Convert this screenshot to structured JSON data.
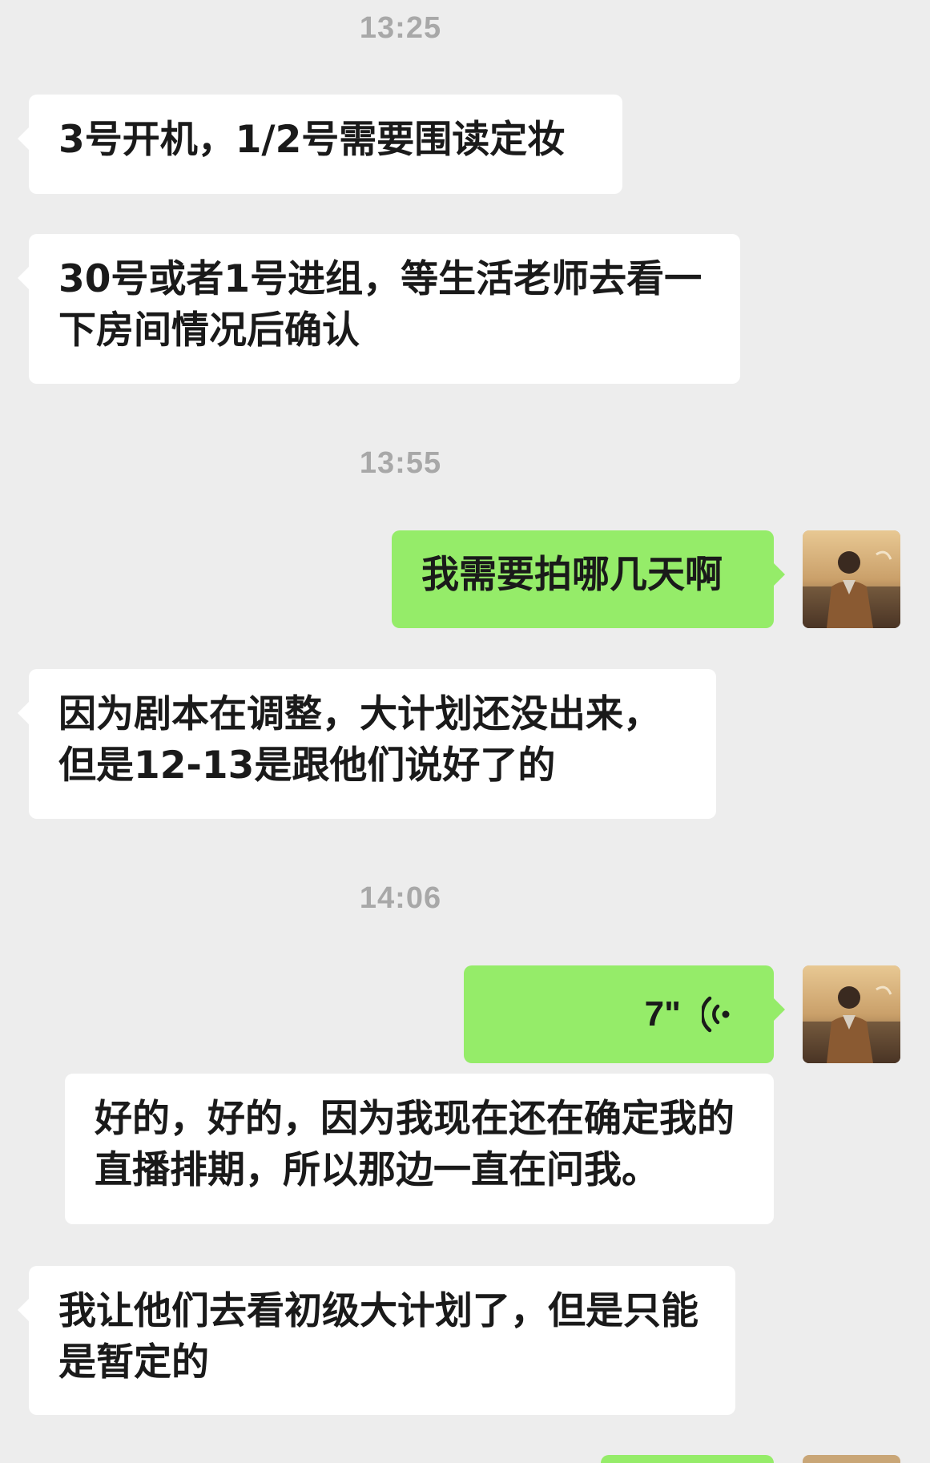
{
  "chat": {
    "timestamps": [
      "13:25",
      "13:55",
      "14:06"
    ],
    "messages": [
      {
        "side": "left",
        "text": "3号开机，1/2号需要围读定妆"
      },
      {
        "side": "left",
        "text": "30号或者1号进组，等生活老师去看一下房间情况后确认"
      },
      {
        "side": "right",
        "text": "我需要拍哪几天啊"
      },
      {
        "side": "left",
        "text": "因为剧本在调整，大计划还没出来，但是12-13是跟他们说好了的"
      },
      {
        "side": "right",
        "type": "voice",
        "duration": "7\""
      },
      {
        "side": "right",
        "text": "好的，好的，因为我现在还在确定我的直播排期，所以那边一直在问我。"
      },
      {
        "side": "left",
        "text": "我让他们去看初级大计划了，但是只能是暂定的"
      }
    ]
  },
  "avatar": {
    "name": "user-avatar"
  },
  "colors": {
    "background": "#ededed",
    "bubble_left": "#ffffff",
    "bubble_right": "#95ec69",
    "timestamp": "#a8a8a8"
  }
}
